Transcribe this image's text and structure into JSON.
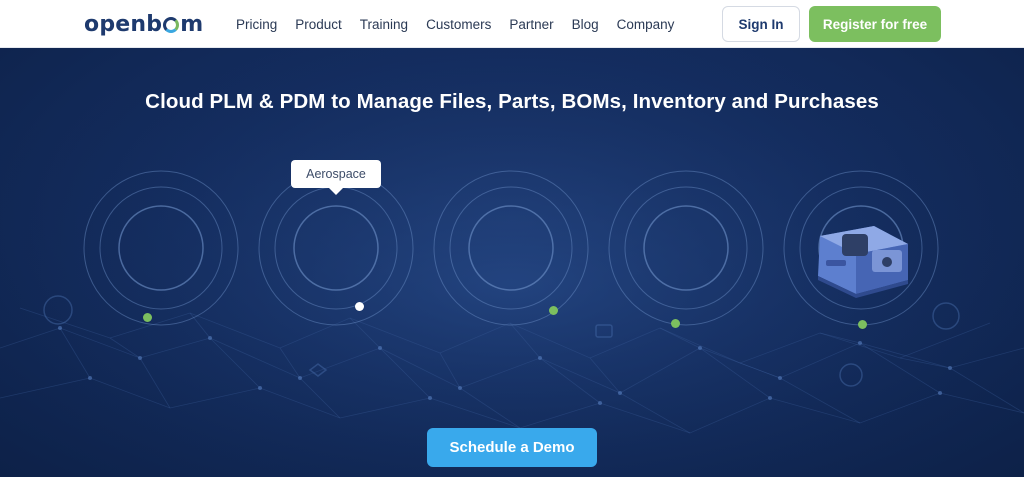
{
  "header": {
    "logo_text": "openbom",
    "nav": [
      "Pricing",
      "Product",
      "Training",
      "Customers",
      "Partner",
      "Blog",
      "Company"
    ],
    "sign_in_label": "Sign In",
    "register_label": "Register for free"
  },
  "hero": {
    "title": "Cloud PLM & PDM to Manage Files, Parts, BOMs, Inventory and Purchases",
    "tooltip": "Aerospace",
    "cta_label": "Schedule a Demo",
    "industries": [
      {
        "icon": "empty-circle-icon",
        "active": false
      },
      {
        "icon": "empty-circle-icon",
        "active": true
      },
      {
        "icon": "empty-circle-icon",
        "active": false
      },
      {
        "icon": "empty-circle-icon",
        "active": false
      },
      {
        "icon": "machine-product-icon",
        "active": false
      }
    ]
  },
  "colors": {
    "brand_dark": "#1e3a6e",
    "accent_green": "#7cbf5f",
    "cta_blue": "#39a9ec",
    "hero_bg": "#142d60"
  }
}
